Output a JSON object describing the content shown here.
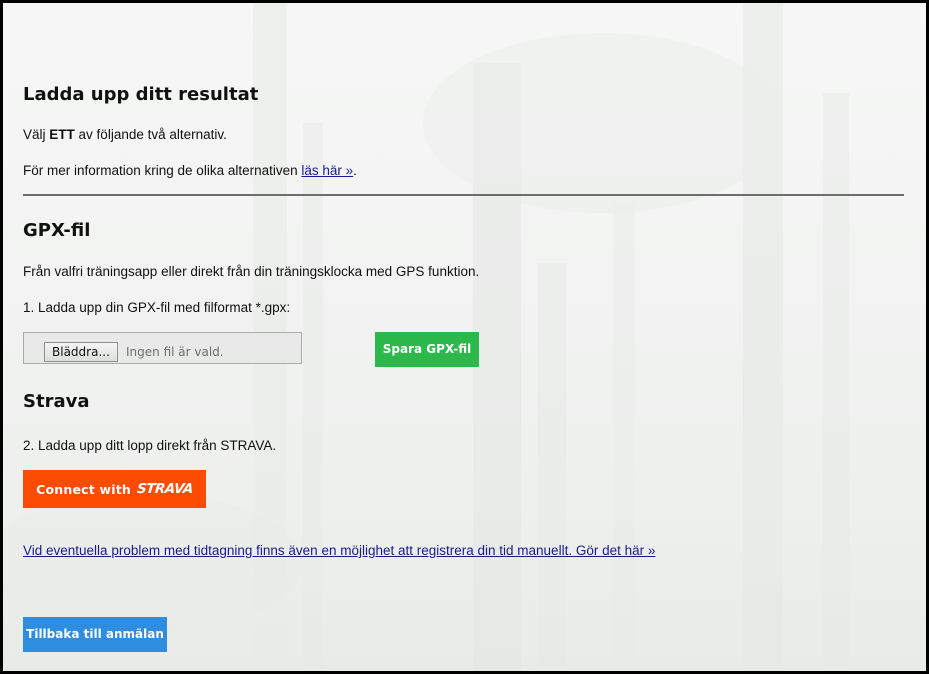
{
  "header": {
    "title": "Ladda upp ditt resultat",
    "choose_prefix": "Välj",
    "choose_bold": "ETT",
    "choose_suffix": "av följande två alternativ.",
    "info_prefix": "För mer information kring de olika alternativen",
    "info_link": "läs här »",
    "info_suffix": "."
  },
  "gpx": {
    "heading": "GPX-fil",
    "description": "Från valfri träningsapp eller direkt från din träningsklocka med GPS funktion.",
    "step": "1. Ladda upp din GPX-fil med filformat *.gpx:",
    "browse_label": "Bläddra...",
    "no_file_text": "Ingen fil är vald.",
    "save_label": "Spara GPX-fil"
  },
  "strava": {
    "heading": "Strava",
    "step": "2. Ladda upp ditt lopp direkt från STRAVA.",
    "connect_text": "Connect with",
    "brand_text": "STRAVA",
    "brand_color": "#fc4c02"
  },
  "manual": {
    "link_text": "Vid eventuella problem med tidtagning finns även en möjlighet att registrera din tid manuellt. Gör det här »"
  },
  "footer": {
    "back_label": "Tillbaka till anmälan"
  },
  "colors": {
    "save_button": "#2db84b",
    "back_button": "#2f8de0",
    "link": "#1a1a8c"
  }
}
